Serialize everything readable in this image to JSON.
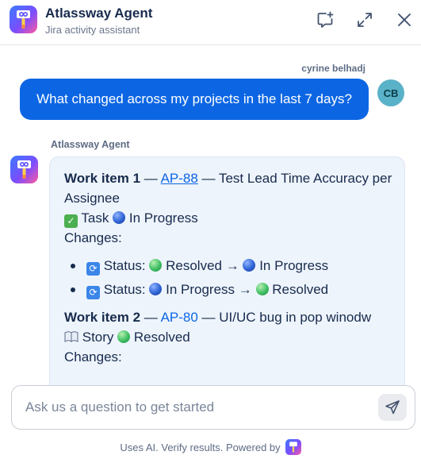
{
  "header": {
    "title": "Atlassway Agent",
    "subtitle": "Jira activity assistant",
    "logo_icon": "atlassway-logo-icon",
    "actions": [
      {
        "name": "new-chat-icon"
      },
      {
        "name": "expand-icon"
      },
      {
        "name": "close-icon"
      }
    ]
  },
  "user_message": {
    "author": "cyrine belhadj",
    "avatar_initials": "CB",
    "text": "What changed across my projects in the last 7 days?"
  },
  "agent_message": {
    "author": "Atlassway Agent",
    "items": [
      {
        "heading": "Work item 1",
        "sep1": " — ",
        "key": "AP-88",
        "sep2": " — ",
        "title": "Test Lead Time Accuracy per Assignee",
        "type": "Task",
        "type_icon": "check-box-icon",
        "status": "In Progress",
        "status_color": "blue",
        "changes_label": "Changes:",
        "changes": [
          {
            "field": "Status:",
            "from": "Resolved",
            "from_color": "green",
            "arrow": "→",
            "to": "In Progress",
            "to_color": "blue"
          },
          {
            "field": "Status:",
            "from": "In Progress",
            "from_color": "blue",
            "arrow": "→",
            "to": "Resolved",
            "to_color": "green"
          }
        ]
      },
      {
        "heading": "Work item 2",
        "sep1": " — ",
        "key": "AP-80",
        "sep2": " — ",
        "title": "UI/UC bug in pop winodw",
        "type": "Story",
        "type_icon": "book-icon",
        "status": "Resolved",
        "status_color": "green",
        "changes_label": "Changes:"
      }
    ]
  },
  "composer": {
    "placeholder": "Ask us a question to get started",
    "send_icon": "send-icon"
  },
  "footer": {
    "text": "Uses AI. Verify results. Powered by"
  },
  "colors": {
    "accent": "#0c66e4",
    "bubble_bg": "#eef4fc",
    "status_blue": "#2f63d6",
    "status_green": "#3fbf63"
  }
}
